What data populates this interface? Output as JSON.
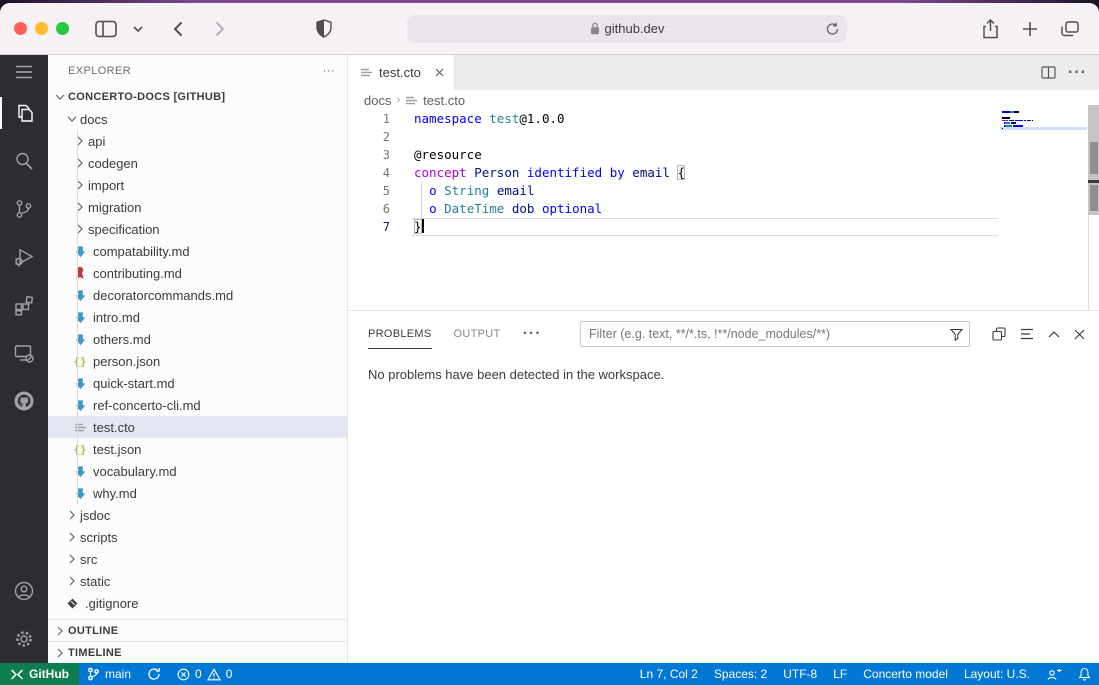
{
  "browser": {
    "url": "github.dev",
    "traffic_lights": [
      "#ff5f57",
      "#febc2e",
      "#28c840"
    ]
  },
  "activity_bar": {
    "top": [
      "menu",
      "explorer",
      "search",
      "source-control",
      "run-and-debug",
      "extensions",
      "remote-explorer",
      "github"
    ],
    "bottom": [
      "accounts",
      "settings"
    ],
    "active": "explorer"
  },
  "sidebar": {
    "header": "EXPLORER",
    "more": "···",
    "tree": [
      {
        "label": "CONCERTO-DOCS [GITHUB]",
        "kind": "folder",
        "level": 0,
        "expanded": true,
        "root": true
      },
      {
        "label": "docs",
        "kind": "folder",
        "level": 1,
        "expanded": true
      },
      {
        "label": "api",
        "kind": "folder",
        "level": 2
      },
      {
        "label": "codegen",
        "kind": "folder",
        "level": 2
      },
      {
        "label": "import",
        "kind": "folder",
        "level": 2
      },
      {
        "label": "migration",
        "kind": "folder",
        "level": 2
      },
      {
        "label": "specification",
        "kind": "folder",
        "level": 2
      },
      {
        "label": "compatability.md",
        "kind": "file",
        "icon": "markdown",
        "level": 2
      },
      {
        "label": "contributing.md",
        "kind": "file",
        "icon": "ribbon",
        "level": 2
      },
      {
        "label": "decoratorcommands.md",
        "kind": "file",
        "icon": "markdown",
        "level": 2
      },
      {
        "label": "intro.md",
        "kind": "file",
        "icon": "markdown",
        "level": 2
      },
      {
        "label": "others.md",
        "kind": "file",
        "icon": "markdown",
        "level": 2
      },
      {
        "label": "person.json",
        "kind": "file",
        "icon": "json",
        "level": 2
      },
      {
        "label": "quick-start.md",
        "kind": "file",
        "icon": "markdown",
        "level": 2
      },
      {
        "label": "ref-concerto-cli.md",
        "kind": "file",
        "icon": "markdown",
        "level": 2
      },
      {
        "label": "test.cto",
        "kind": "file",
        "icon": "cto",
        "level": 2,
        "selected": true
      },
      {
        "label": "test.json",
        "kind": "file",
        "icon": "json",
        "level": 2
      },
      {
        "label": "vocabulary.md",
        "kind": "file",
        "icon": "markdown",
        "level": 2
      },
      {
        "label": "why.md",
        "kind": "file",
        "icon": "markdown",
        "level": 2
      },
      {
        "label": "jsdoc",
        "kind": "folder",
        "level": 1
      },
      {
        "label": "scripts",
        "kind": "folder",
        "level": 1
      },
      {
        "label": "src",
        "kind": "folder",
        "level": 1
      },
      {
        "label": "static",
        "kind": "folder",
        "level": 1
      },
      {
        "label": ".gitignore",
        "kind": "file",
        "icon": "git",
        "level": 1
      }
    ],
    "sections": [
      "OUTLINE",
      "TIMELINE"
    ]
  },
  "editor": {
    "tab_label": "test.cto",
    "breadcrumb": {
      "folder": "docs",
      "file": "test.cto"
    },
    "token_colors": {
      "kw": "#0000ff",
      "ctrl": "#af00db",
      "ty": "#267f99",
      "vr": "#001080",
      "deco": "#000000",
      "ver": "#000000",
      "pl": "#000000",
      "brk": "#000000"
    },
    "lines": [
      {
        "num": 1,
        "tokens": [
          [
            "namespace",
            "kw"
          ],
          [
            " ",
            "pl"
          ],
          [
            "test",
            "ty"
          ],
          [
            "@1.0.0",
            "ver"
          ]
        ]
      },
      {
        "num": 2,
        "tokens": []
      },
      {
        "num": 3,
        "tokens": [
          [
            "@resource",
            "deco"
          ]
        ]
      },
      {
        "num": 4,
        "tokens": [
          [
            "concept",
            "ctrl"
          ],
          [
            " ",
            "pl"
          ],
          [
            "Person",
            "vr"
          ],
          [
            " ",
            "pl"
          ],
          [
            "identified",
            "kw"
          ],
          [
            " ",
            "pl"
          ],
          [
            "by",
            "kw"
          ],
          [
            " ",
            "pl"
          ],
          [
            "email",
            "vr"
          ],
          [
            " ",
            "pl"
          ],
          [
            "{",
            "brk"
          ]
        ]
      },
      {
        "num": 5,
        "tokens": [
          [
            "  ",
            "pl"
          ],
          [
            "o",
            "kw"
          ],
          [
            " ",
            "pl"
          ],
          [
            "String",
            "ty"
          ],
          [
            " ",
            "pl"
          ],
          [
            "email",
            "vr"
          ]
        ]
      },
      {
        "num": 6,
        "tokens": [
          [
            "  ",
            "pl"
          ],
          [
            "o",
            "kw"
          ],
          [
            " ",
            "pl"
          ],
          [
            "DateTime",
            "ty"
          ],
          [
            " ",
            "pl"
          ],
          [
            "dob",
            "vr"
          ],
          [
            " ",
            "pl"
          ],
          [
            "optional",
            "kw"
          ]
        ]
      },
      {
        "num": 7,
        "tokens": [
          [
            "}",
            "brk"
          ]
        ],
        "current": true,
        "cursor": true
      }
    ]
  },
  "panel": {
    "tabs": [
      {
        "label": "PROBLEMS",
        "active": true
      },
      {
        "label": "OUTPUT",
        "active": false
      }
    ],
    "more": "···",
    "filter_placeholder": "Filter (e.g. text, **/*.ts, !**/node_modules/**)",
    "message": "No problems have been detected in the workspace."
  },
  "status_bar": {
    "left": [
      {
        "name": "remote",
        "icon": "remote-indicator",
        "label": "GitHub"
      },
      {
        "name": "branch",
        "icon": "git-branch",
        "label": "main"
      },
      {
        "name": "sync",
        "icon": "sync",
        "label": ""
      },
      {
        "name": "problems",
        "icon": "error-warning",
        "errors": "0",
        "warnings": "0"
      }
    ],
    "right": [
      {
        "name": "cursor-position",
        "label": "Ln 7, Col 2"
      },
      {
        "name": "indentation",
        "label": "Spaces: 2"
      },
      {
        "name": "encoding",
        "label": "UTF-8"
      },
      {
        "name": "eol",
        "label": "LF"
      },
      {
        "name": "language-mode",
        "label": "Concerto model"
      },
      {
        "name": "keyboard-layout",
        "label": "Layout: U.S."
      },
      {
        "name": "feedback",
        "icon": "feedback",
        "label": ""
      },
      {
        "name": "notifications",
        "icon": "bell",
        "label": ""
      }
    ]
  }
}
